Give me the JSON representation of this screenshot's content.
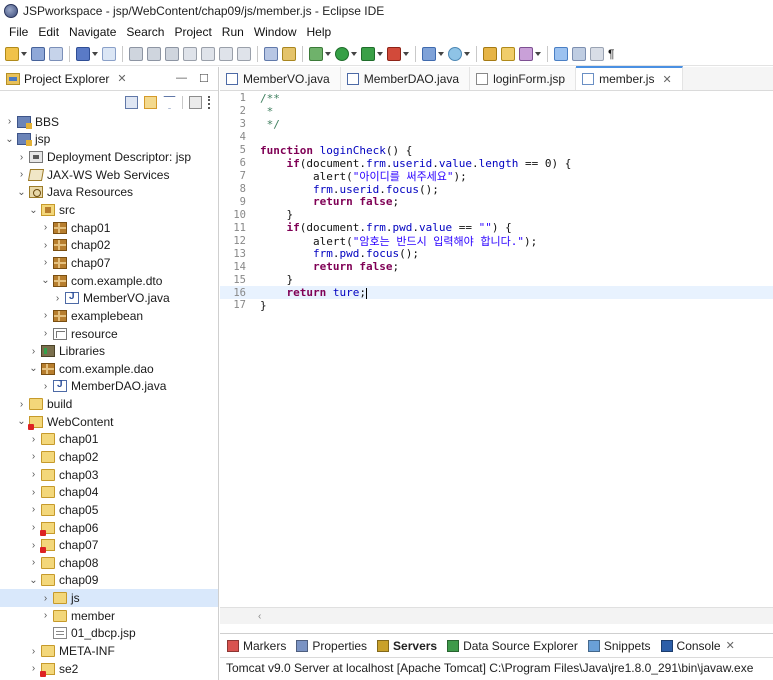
{
  "window": {
    "title": "JSPworkspace - jsp/WebContent/chap09/js/member.js - Eclipse IDE"
  },
  "menu": [
    "File",
    "Edit",
    "Navigate",
    "Search",
    "Project",
    "Run",
    "Window",
    "Help"
  ],
  "explorer": {
    "tab_label": "Project Explorer",
    "tree": [
      {
        "level": 0,
        "arrow": "›",
        "icon": "project",
        "label": "BBS"
      },
      {
        "level": 0,
        "arrow": "⌄",
        "icon": "project",
        "label": "jsp"
      },
      {
        "level": 1,
        "arrow": "›",
        "icon": "deploy",
        "label": "Deployment Descriptor: jsp"
      },
      {
        "level": 1,
        "arrow": "›",
        "icon": "ws",
        "label": "JAX-WS Web Services"
      },
      {
        "level": 1,
        "arrow": "⌄",
        "icon": "res",
        "label": "Java Resources"
      },
      {
        "level": 2,
        "arrow": "⌄",
        "icon": "src",
        "label": "src"
      },
      {
        "level": 3,
        "arrow": "›",
        "icon": "package",
        "label": "chap01"
      },
      {
        "level": 3,
        "arrow": "›",
        "icon": "package",
        "label": "chap02"
      },
      {
        "level": 3,
        "arrow": "›",
        "icon": "package",
        "label": "chap07"
      },
      {
        "level": 3,
        "arrow": "⌄",
        "icon": "package",
        "label": "com.example.dto"
      },
      {
        "level": 4,
        "arrow": "›",
        "icon": "java",
        "label": "MemberVO.java"
      },
      {
        "level": 3,
        "arrow": "›",
        "icon": "package",
        "label": "examplebean"
      },
      {
        "level": 3,
        "arrow": "›",
        "icon": "resource",
        "label": "resource"
      },
      {
        "level": 2,
        "arrow": "›",
        "icon": "lib",
        "label": "Libraries"
      },
      {
        "level": 2,
        "arrow": "⌄",
        "icon": "package",
        "label": "com.example.dao"
      },
      {
        "level": 3,
        "arrow": "›",
        "icon": "java",
        "label": "MemberDAO.java"
      },
      {
        "level": 1,
        "arrow": "›",
        "icon": "folder",
        "label": "build"
      },
      {
        "level": 1,
        "arrow": "⌄",
        "icon": "folder-red",
        "label": "WebContent"
      },
      {
        "level": 2,
        "arrow": "›",
        "icon": "folder",
        "label": "chap01"
      },
      {
        "level": 2,
        "arrow": "›",
        "icon": "folder",
        "label": "chap02"
      },
      {
        "level": 2,
        "arrow": "›",
        "icon": "folder",
        "label": "chap03"
      },
      {
        "level": 2,
        "arrow": "›",
        "icon": "folder",
        "label": "chap04"
      },
      {
        "level": 2,
        "arrow": "›",
        "icon": "folder",
        "label": "chap05"
      },
      {
        "level": 2,
        "arrow": "›",
        "icon": "folder-red",
        "label": "chap06"
      },
      {
        "level": 2,
        "arrow": "›",
        "icon": "folder-red",
        "label": "chap07"
      },
      {
        "level": 2,
        "arrow": "›",
        "icon": "folder",
        "label": "chap08"
      },
      {
        "level": 2,
        "arrow": "⌄",
        "icon": "folder",
        "label": "chap09"
      },
      {
        "level": 3,
        "arrow": "›",
        "icon": "folder",
        "label": "js",
        "selected": true
      },
      {
        "level": 3,
        "arrow": "›",
        "icon": "folder",
        "label": "member"
      },
      {
        "level": 3,
        "arrow": "",
        "icon": "jsp",
        "label": "01_dbcp.jsp"
      },
      {
        "level": 2,
        "arrow": "›",
        "icon": "folder",
        "label": "META-INF"
      },
      {
        "level": 2,
        "arrow": "›",
        "icon": "folder-red",
        "label": "se2"
      }
    ]
  },
  "editor": {
    "tabs": [
      {
        "label": "MemberVO.java",
        "icon": "java",
        "active": false
      },
      {
        "label": "MemberDAO.java",
        "icon": "java",
        "active": false
      },
      {
        "label": "loginForm.jsp",
        "icon": "jsp",
        "active": false
      },
      {
        "label": "member.js",
        "icon": "js",
        "active": true
      }
    ],
    "lines": [
      {
        "n": "1",
        "html": "<span class=\"cm\">/**</span>"
      },
      {
        "n": "2",
        "html": "<span class=\"cm\"> *</span>"
      },
      {
        "n": "3",
        "html": "<span class=\"cm\"> */</span>"
      },
      {
        "n": "4",
        "html": ""
      },
      {
        "n": "5",
        "html": "<span class=\"kw\">function</span> <span class=\"prop\">loginCheck</span>() {"
      },
      {
        "n": "6",
        "html": "    <span class=\"kw\">if</span>(document.<span class=\"prop\">frm</span>.<span class=\"prop\">userid</span>.<span class=\"prop\">value</span>.<span class=\"prop\">length</span> == 0) {"
      },
      {
        "n": "7",
        "html": "        alert(<span class=\"str\">\"아이디를 써주세요\"</span>);"
      },
      {
        "n": "8",
        "html": "        <span class=\"prop\">frm</span>.<span class=\"prop\">userid</span>.<span class=\"prop\">focus</span>();"
      },
      {
        "n": "9",
        "html": "        <span class=\"kw\">return</span> <span class=\"kw\">false</span>;"
      },
      {
        "n": "10",
        "html": "    }"
      },
      {
        "n": "11",
        "html": "    <span class=\"kw\">if</span>(document.<span class=\"prop\">frm</span>.<span class=\"prop\">pwd</span>.<span class=\"prop\">value</span> == <span class=\"str\">\"\"</span>) {"
      },
      {
        "n": "12",
        "html": "        alert(<span class=\"str\">\"암호는 반드시 입력해야 합니다.\"</span>);"
      },
      {
        "n": "13",
        "html": "        <span class=\"prop\">frm</span>.<span class=\"prop\">pwd</span>.<span class=\"prop\">focus</span>();"
      },
      {
        "n": "14",
        "html": "        <span class=\"kw\">return</span> <span class=\"kw\">false</span>;"
      },
      {
        "n": "15",
        "html": "    }"
      },
      {
        "n": "16",
        "html": "    <span class=\"kw\">return</span> <span class=\"prop\">ture</span>;<span class=\"caret\"></span>",
        "current": true
      },
      {
        "n": "17",
        "html": "}"
      }
    ],
    "hscroll_arrow": "‹"
  },
  "bottom": {
    "tabs": [
      {
        "label": "Markers",
        "active": false
      },
      {
        "label": "Properties",
        "active": false
      },
      {
        "label": "Servers",
        "active": true
      },
      {
        "label": "Data Source Explorer",
        "active": false
      },
      {
        "label": "Snippets",
        "active": false
      },
      {
        "label": "Console",
        "active": false,
        "closable": true
      }
    ],
    "console_text": "Tomcat v9.0 Server at localhost [Apache Tomcat] C:\\Program Files\\Java\\jre1.8.0_291\\bin\\javaw.exe"
  },
  "colors": {
    "selection": "#d9e8fb",
    "current_line": "#e8f2fe",
    "keyword": "#7f0055",
    "string": "#2a00ff",
    "comment": "#3f7f5f"
  }
}
